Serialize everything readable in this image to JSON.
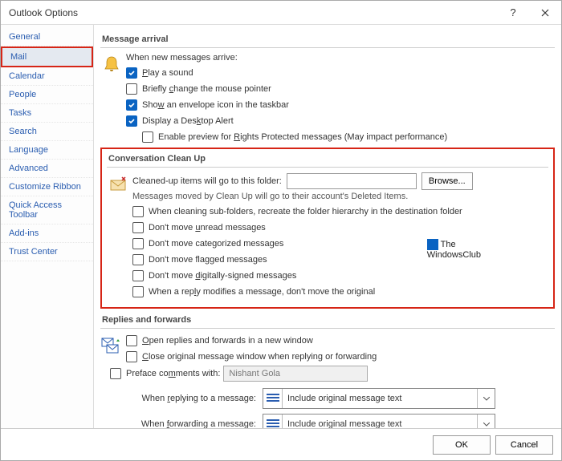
{
  "title": "Outlook Options",
  "sidebar": {
    "items": [
      {
        "label": "General"
      },
      {
        "label": "Mail"
      },
      {
        "label": "Calendar"
      },
      {
        "label": "People"
      },
      {
        "label": "Tasks"
      },
      {
        "label": "Search"
      },
      {
        "label": "Language"
      },
      {
        "label": "Advanced"
      },
      {
        "label": "Customize Ribbon"
      },
      {
        "label": "Quick Access Toolbar"
      },
      {
        "label": "Add-ins"
      },
      {
        "label": "Trust Center"
      }
    ],
    "selected": "Mail"
  },
  "sections": {
    "arrival": {
      "title": "Message arrival",
      "intro": "When new messages arrive:",
      "items": {
        "play_sound": {
          "label": "Play a sound",
          "checked": true
        },
        "change_pointer": {
          "label_pre": "Briefly ",
          "ul": "c",
          "label_post": "hange the mouse pointer",
          "checked": false
        },
        "envelope": {
          "label_pre": "Sho",
          "ul": "w",
          "label_post": " an envelope icon in the taskbar",
          "checked": true
        },
        "desktop_alert": {
          "label_pre": "Display a Des",
          "ul": "k",
          "label_post": "top Alert",
          "checked": true
        },
        "preview_rights": {
          "label_pre": "Enable preview for ",
          "ul": "R",
          "label_post": "ights Protected messages (May impact performance)",
          "checked": false
        }
      }
    },
    "cleanup": {
      "title": "Conversation Clean Up",
      "folder_label": "Cleaned-up items will go to this folder:",
      "folder_value": "",
      "browse": "Browse...",
      "note": "Messages moved by Clean Up will go to their account's Deleted Items.",
      "items": {
        "recreate": {
          "label": "When cleaning sub-folders, recreate the folder hierarchy in the destination folder",
          "checked": false
        },
        "unread": {
          "label_pre": "Don't move ",
          "ul": "u",
          "label_post": "nread messages",
          "checked": false
        },
        "categorized": {
          "label": "Don't move categorized messages",
          "checked": false
        },
        "flagged": {
          "label": "Don't move flagged messages",
          "checked": false
        },
        "signed": {
          "label_pre": "Don't move ",
          "ul": "d",
          "label_post": "igitally-signed messages",
          "checked": false
        },
        "reply_modifies": {
          "label_pre": "When a rep",
          "ul": "l",
          "label_post": "y modifies a message, don't move the original",
          "checked": false
        }
      }
    },
    "replies": {
      "title": "Replies and forwards",
      "open_new": {
        "label_pre": "",
        "ul": "O",
        "label_post": "pen replies and forwards in a new window",
        "checked": false
      },
      "close_orig": {
        "label_pre": "",
        "ul": "C",
        "label_post": "lose original message window when replying or forwarding",
        "checked": false
      },
      "preface": {
        "label_pre": "Preface co",
        "ul": "m",
        "label_post": "ments with:",
        "checked": false,
        "value": "Nishant Gola"
      },
      "when_reply": {
        "label_pre": "When ",
        "ul": "r",
        "label_post": "eplying to a message:",
        "value": "Include original message text"
      },
      "when_forward": {
        "label_pre": "When ",
        "ul": "f",
        "label_post": "orwarding a message:",
        "value": "Include original message text"
      }
    }
  },
  "footer": {
    "ok": "OK",
    "cancel": "Cancel"
  },
  "watermark": {
    "line1": "The",
    "line2": "WindowsClub"
  }
}
